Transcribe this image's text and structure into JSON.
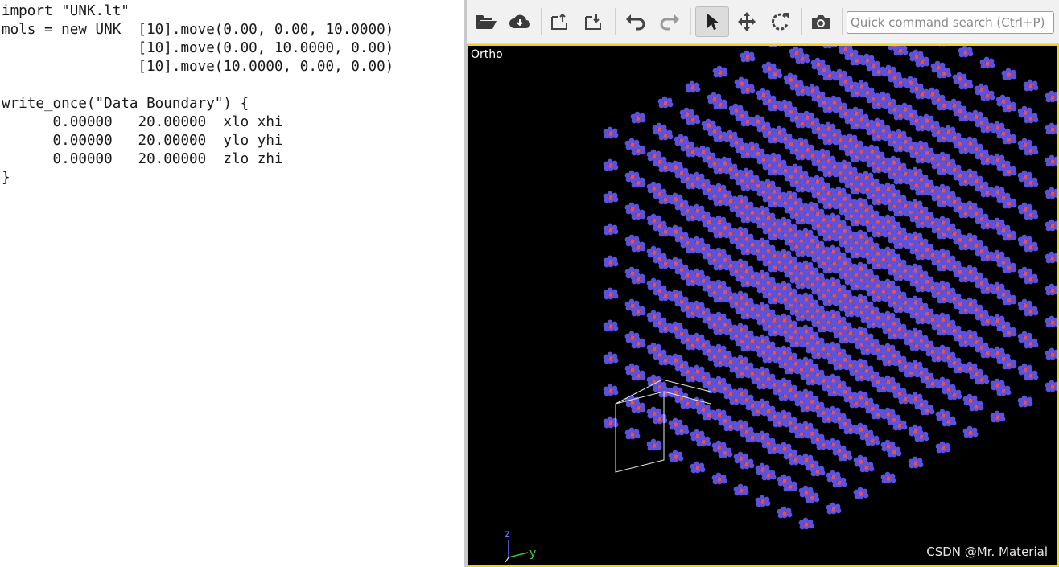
{
  "editor": {
    "code_lines": [
      "import \"UNK.lt\"",
      "mols = new UNK  [10].move(0.00, 0.00, 10.0000)",
      "                [10].move(0.00, 10.0000, 0.00)",
      "                [10].move(10.0000, 0.00, 0.00)",
      "",
      "write_once(\"Data Boundary\") {",
      "      0.00000   20.00000  xlo xhi",
      "      0.00000   20.00000  ylo yhi",
      "      0.00000   20.00000  zlo zhi",
      "}"
    ]
  },
  "toolbar": {
    "buttons": [
      {
        "name": "open-file-icon"
      },
      {
        "name": "cloud-download-icon"
      },
      {
        "name": "export-icon"
      },
      {
        "name": "import-icon"
      },
      {
        "name": "undo-icon"
      },
      {
        "name": "redo-icon",
        "disabled": true
      },
      {
        "name": "select-pointer-icon",
        "active": true
      },
      {
        "name": "pan-move-icon"
      },
      {
        "name": "rotate-icon"
      },
      {
        "name": "camera-icon"
      }
    ],
    "search_placeholder": "Quick command search (Ctrl+P)"
  },
  "viewport": {
    "projection_label": "Ortho",
    "axis_z_label": "z",
    "axis_y_label": "y",
    "background": "#000000",
    "border_color": "#f2d21b",
    "molecule_colors": {
      "blue": "#5b52e0",
      "red": "#e2505a"
    },
    "lattice": {
      "count_per_axis": 10
    }
  },
  "watermark": "CSDN @Mr. Material"
}
